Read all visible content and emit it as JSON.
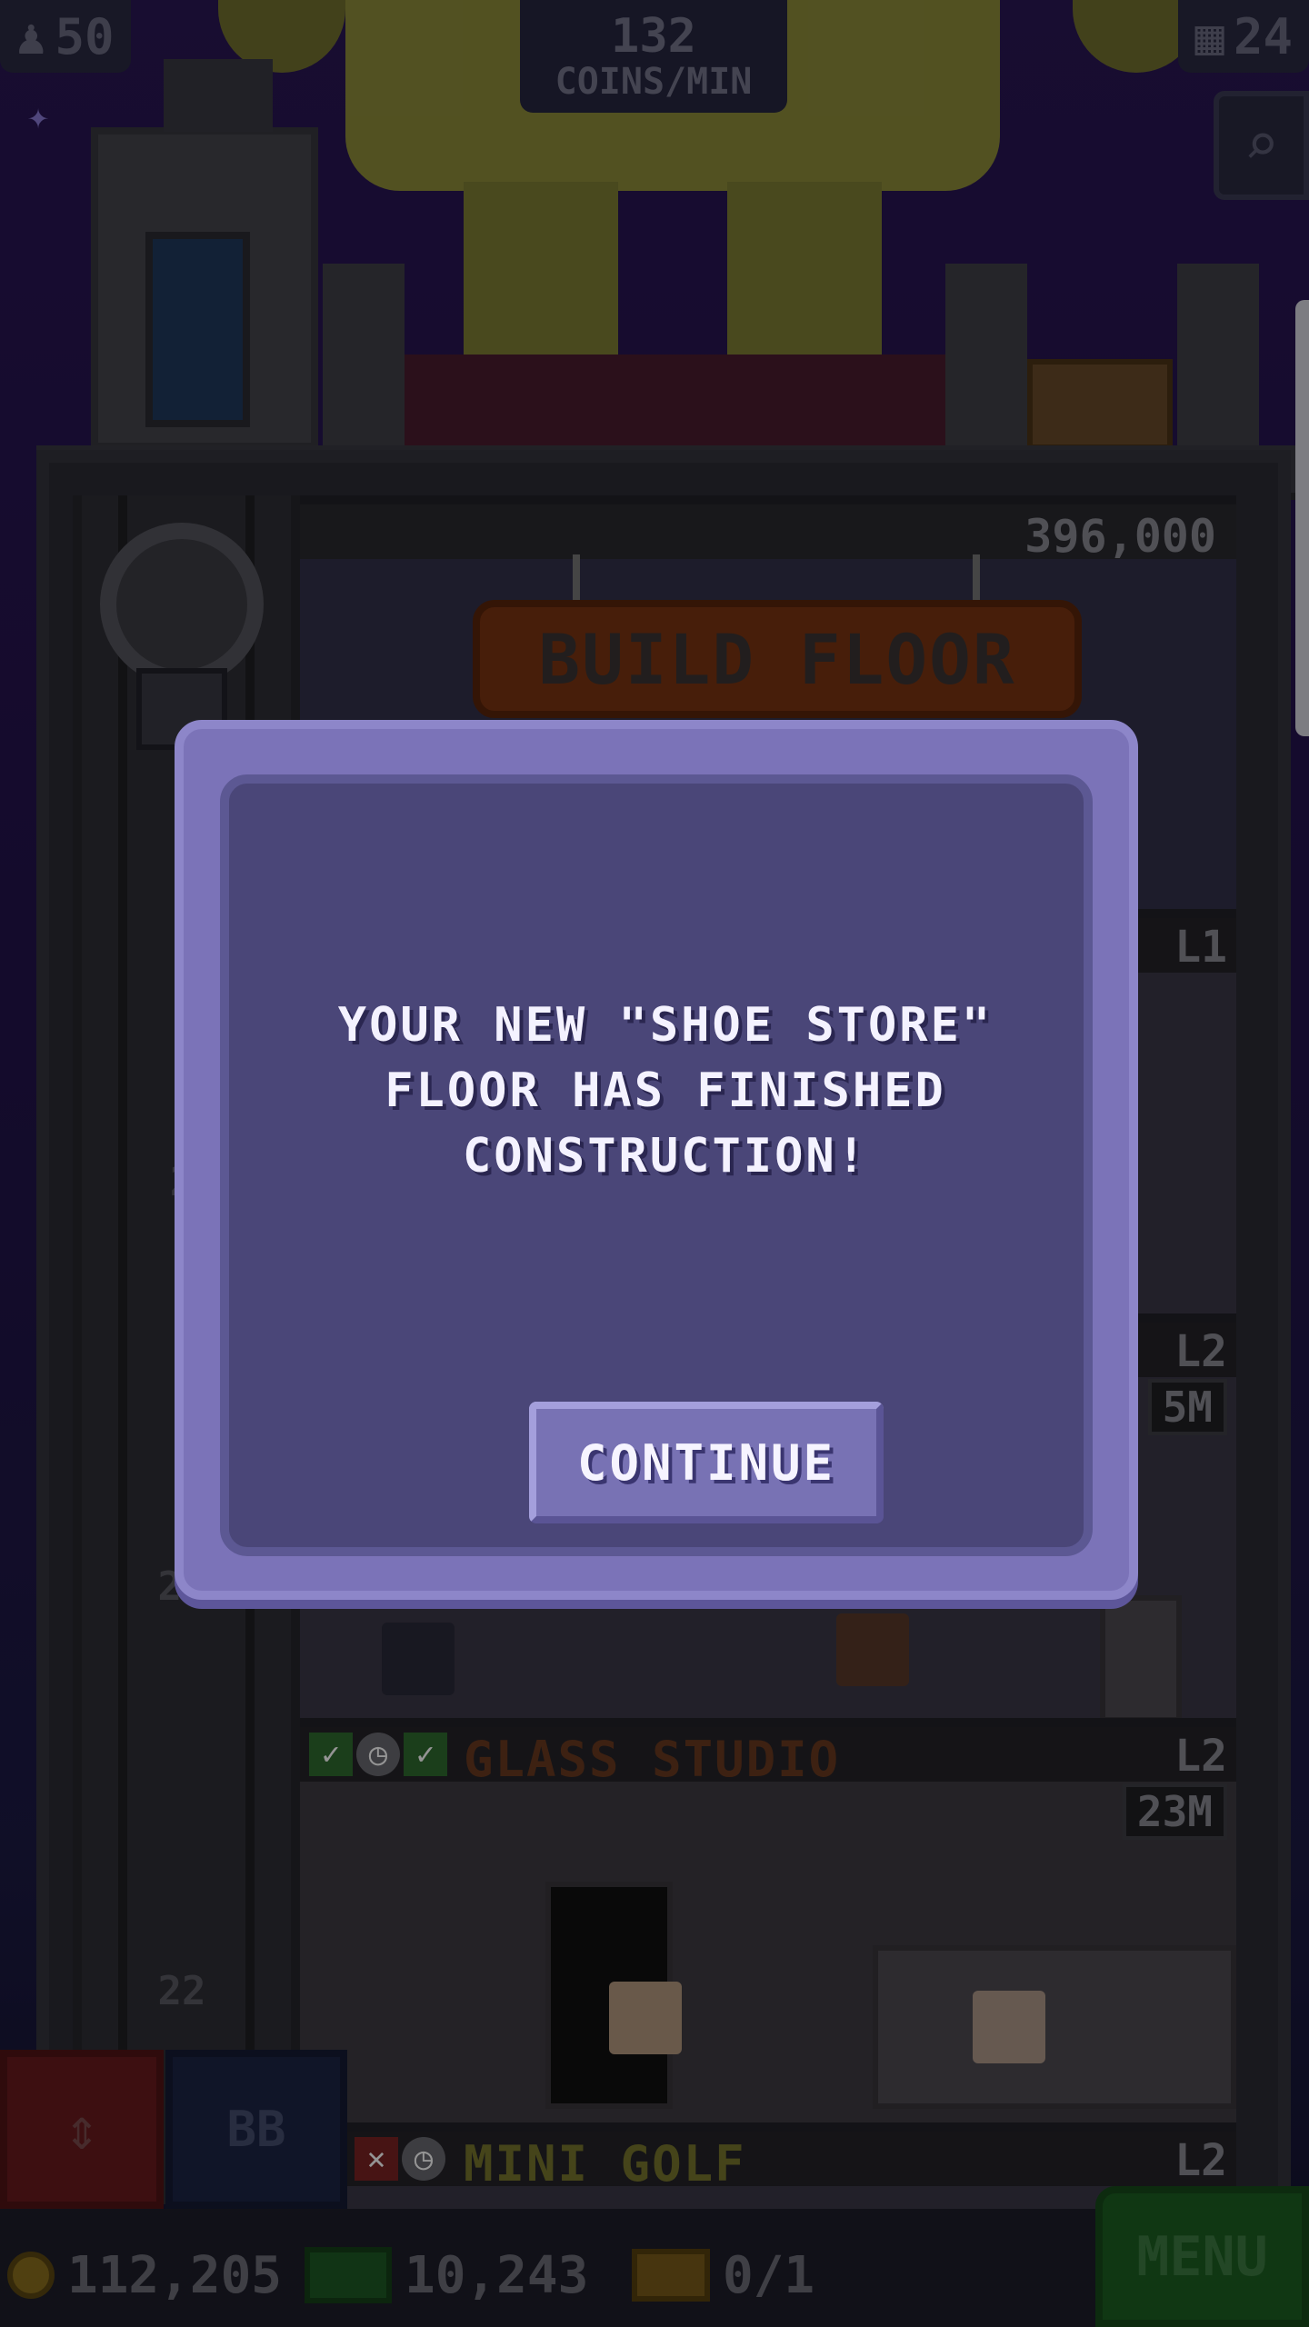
{
  "hud": {
    "population": "50",
    "coins_per_min_value": "132",
    "coins_per_min_unit": "COINS/MIN",
    "floors": "24"
  },
  "tower": {
    "top_price": "396,000",
    "build_floor_label": "BUILD FLOOR",
    "floors": [
      {
        "level": "L1",
        "price": ""
      },
      {
        "level": "L2",
        "price": "5M"
      },
      {
        "name": "GLASS STUDIO",
        "level": "L2",
        "price": "23M",
        "status_icons": [
          "check-icon",
          "clock-icon",
          "check-icon"
        ]
      },
      {
        "name": "MINI GOLF",
        "level": "L2",
        "status_icons": [
          "cross-icon",
          "clock-icon"
        ]
      }
    ],
    "elevator_floor_numbers": [
      "2",
      "23",
      "22"
    ]
  },
  "dialog": {
    "message": "YOUR NEW \"SHOE STORE\"\nFLOOR HAS FINISHED\nCONSTRUCTION!",
    "continue_label": "CONTINUE"
  },
  "bottom_bar": {
    "coins": "112,205",
    "bux": "10,243",
    "tickets": "0/1",
    "bb_label": "BB",
    "menu_label": "MENU"
  },
  "colors": {
    "dialog_outer": "#7b73b8",
    "dialog_inner": "#4a4678",
    "button": "#7872b4",
    "menu_green": "#1c5f22",
    "glass_studio_title": "#6a3a20",
    "mini_golf_title": "#77752e"
  }
}
